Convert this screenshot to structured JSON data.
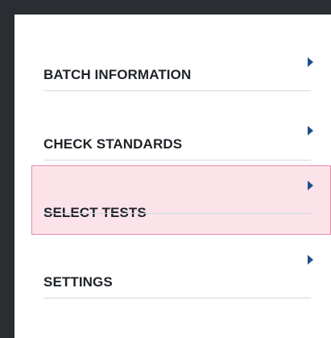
{
  "menu": {
    "items": [
      {
        "label": "BATCH INFORMATION",
        "selected": false,
        "icon": "chevron-right-icon"
      },
      {
        "label": "CHECK STANDARDS",
        "selected": false,
        "icon": "chevron-right-icon"
      },
      {
        "label": "SELECT TESTS",
        "selected": true,
        "icon": "chevron-right-icon"
      },
      {
        "label": "SETTINGS",
        "selected": false,
        "icon": "chevron-right-icon"
      }
    ]
  },
  "colors": {
    "background": "#2a2d31",
    "panel": "#ffffff",
    "text": "#1f2328",
    "arrow": "#1f4f8a",
    "selected_fill": "#fce3ea",
    "selected_border": "#e88aa6",
    "divider": "#cfd9e2"
  }
}
